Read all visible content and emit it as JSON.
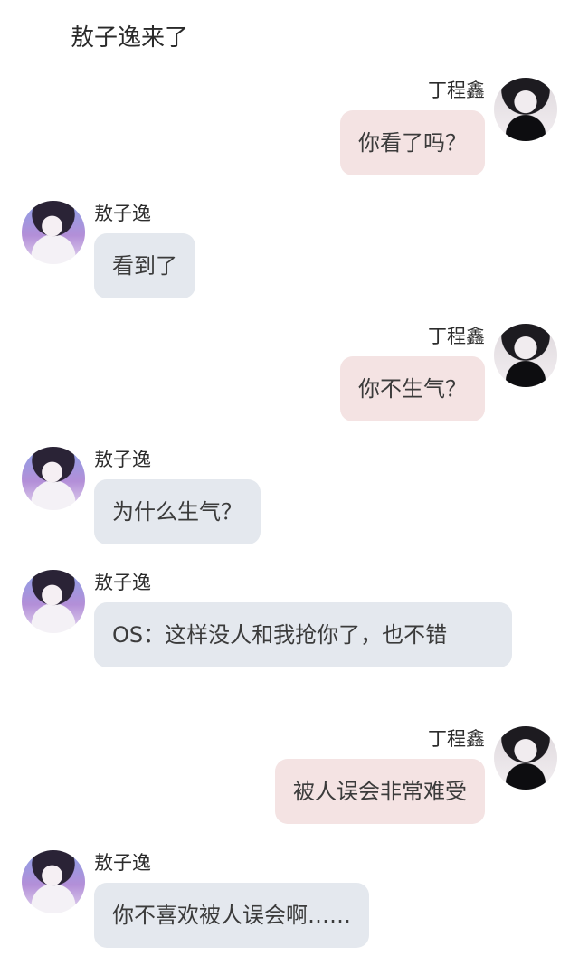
{
  "header": {
    "title": "敖子逸来了"
  },
  "messages": [
    {
      "sender": "丁程鑫",
      "side": "right",
      "text": "你看了吗？"
    },
    {
      "sender": "敖子逸",
      "side": "left",
      "text": "看到了"
    },
    {
      "sender": "丁程鑫",
      "side": "right",
      "text": "你不生气？"
    },
    {
      "sender": "敖子逸",
      "side": "left",
      "text": "为什么生气？"
    },
    {
      "sender": "敖子逸",
      "side": "left",
      "text": "OS：这样没人和我抢你了，也不错"
    },
    {
      "sender": "丁程鑫",
      "side": "right",
      "text": "被人误会非常难受"
    },
    {
      "sender": "敖子逸",
      "side": "left",
      "text": "你不喜欢被人误会啊……"
    }
  ],
  "colors": {
    "right_bubble": "#f4e3e3",
    "left_bubble": "#e4e8ee",
    "text": "#3b3b3b"
  }
}
